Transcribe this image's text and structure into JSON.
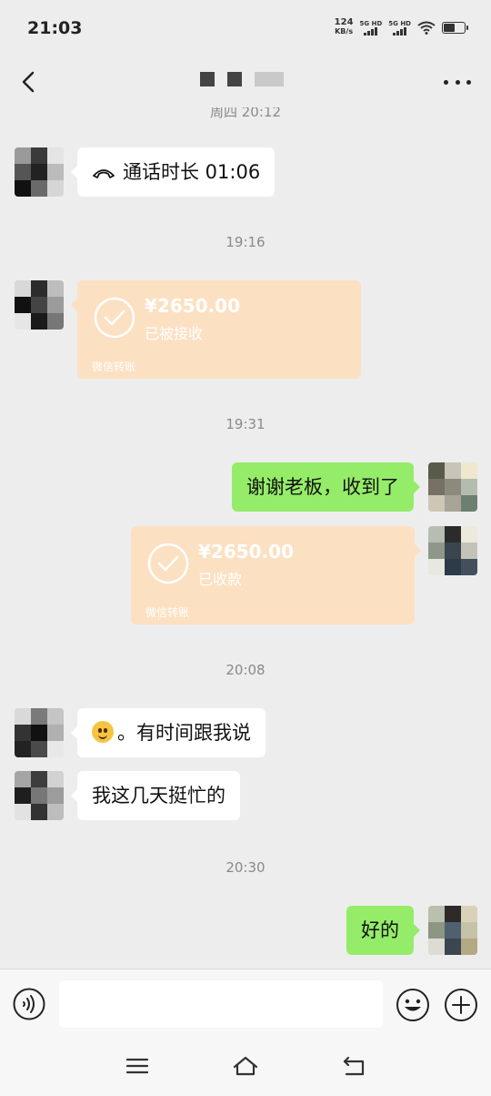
{
  "status_bar": {
    "time": "21:03",
    "net_speed_value": "124",
    "net_speed_unit": "KB/s",
    "signal_1_label": "5G HD",
    "signal_2_label": "5G HD",
    "battery_level": 0.55
  },
  "header": {
    "title": "",
    "back_icon": "chevron-left-icon",
    "more_icon": "more-dots-icon"
  },
  "chat": {
    "partial_timestamp": "周四 20:12",
    "messages": [
      {
        "type": "call",
        "side": "in",
        "text": "通话时长 01:06"
      },
      {
        "type": "time",
        "text": "19:16"
      },
      {
        "type": "transfer",
        "side": "in",
        "amount": "¥2650.00",
        "status": "已被接收",
        "footer": "微信转账"
      },
      {
        "type": "time",
        "text": "19:31"
      },
      {
        "type": "text",
        "side": "out",
        "text": "谢谢老板，收到了"
      },
      {
        "type": "transfer",
        "side": "out",
        "amount": "¥2650.00",
        "status": "已收款",
        "footer": "微信转账"
      },
      {
        "type": "time",
        "text": "20:08"
      },
      {
        "type": "text",
        "side": "in",
        "text": "。有时间跟我说",
        "emoji": "smile-emoji"
      },
      {
        "type": "text",
        "side": "in",
        "text": "我这几天挺忙的"
      },
      {
        "type": "time",
        "text": "20:30"
      },
      {
        "type": "text",
        "side": "out",
        "text": "好的"
      }
    ]
  },
  "input_bar": {
    "placeholder": "",
    "voice_icon": "voice-icon",
    "emoji_icon": "emoji-icon",
    "plus_icon": "plus-icon"
  },
  "nav_bar": {
    "menu_icon": "menu-icon",
    "home_icon": "home-icon",
    "back_icon": "back-icon"
  },
  "colors": {
    "background": "#ededed",
    "outgoing_bubble": "#95ec69",
    "incoming_bubble": "#ffffff",
    "transfer_card": "#fce0c2"
  }
}
